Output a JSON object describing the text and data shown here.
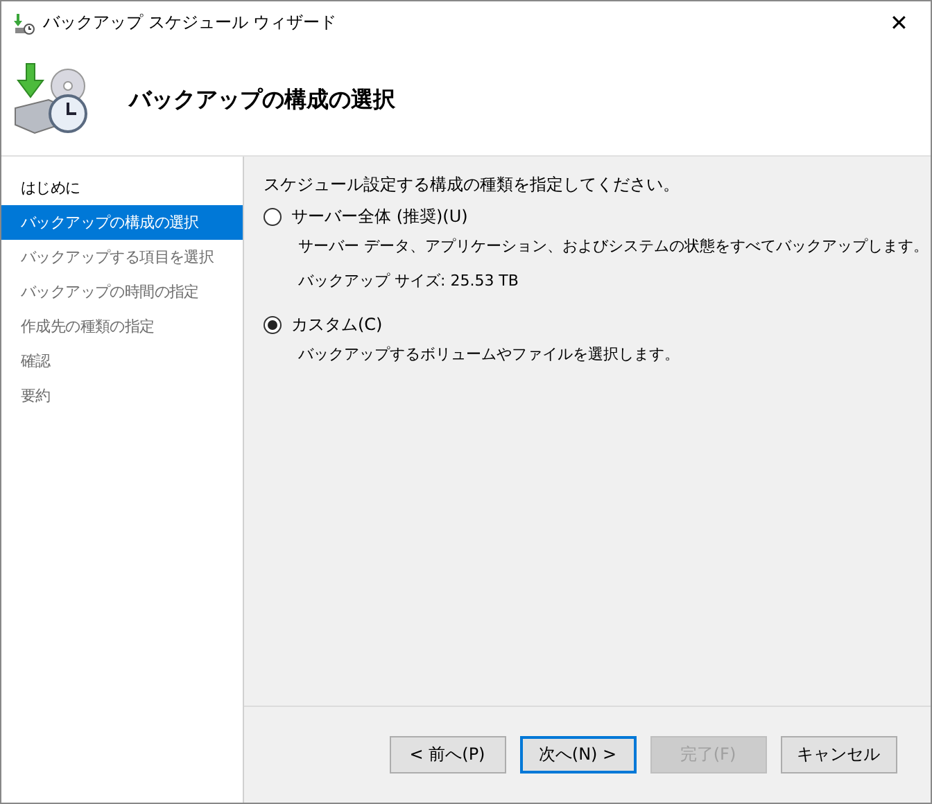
{
  "window": {
    "title": "バックアップ スケジュール ウィザード",
    "close": "✕"
  },
  "header": {
    "title": "バックアップの構成の選択"
  },
  "sidebar": {
    "items": [
      {
        "label": "はじめに",
        "selected": false,
        "disabled": false
      },
      {
        "label": "バックアップの構成の選択",
        "selected": true,
        "disabled": false
      },
      {
        "label": "バックアップする項目を選択",
        "selected": false,
        "disabled": true
      },
      {
        "label": "バックアップの時間の指定",
        "selected": false,
        "disabled": true
      },
      {
        "label": "作成先の種類の指定",
        "selected": false,
        "disabled": true
      },
      {
        "label": "確認",
        "selected": false,
        "disabled": true
      },
      {
        "label": "要約",
        "selected": false,
        "disabled": true
      }
    ]
  },
  "content": {
    "prompt": "スケジュール設定する構成の種類を指定してください。",
    "options": [
      {
        "label": "サーバー全体 (推奨)(U)",
        "selected": false,
        "description": "サーバー データ、アプリケーション、およびシステムの状態をすべてバックアップします。",
        "detail": "バックアップ サイズ: 25.53 TB"
      },
      {
        "label": "カスタム(C)",
        "selected": true,
        "description": "バックアップするボリュームやファイルを選択します。"
      }
    ]
  },
  "buttons": [
    {
      "label": "< 前へ(P)",
      "disabled": false,
      "focused": false
    },
    {
      "label": "次へ(N) >",
      "disabled": false,
      "focused": true
    },
    {
      "label": "完了(F)",
      "disabled": true,
      "focused": false
    },
    {
      "label": "キャンセル",
      "disabled": false,
      "focused": false
    }
  ]
}
